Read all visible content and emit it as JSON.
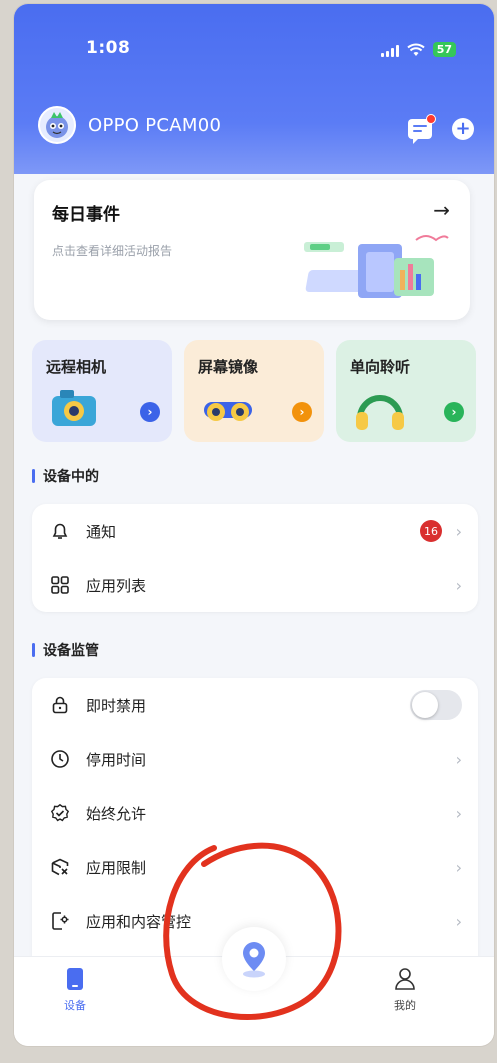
{
  "status": {
    "time": "1:08",
    "battery": "57"
  },
  "header": {
    "device_name": "OPPO PCAM00"
  },
  "daily": {
    "title": "每日事件",
    "subtitle": "点击查看详细活动报告"
  },
  "quick": [
    {
      "label": "远程相机"
    },
    {
      "label": "屏幕镜像"
    },
    {
      "label": "单向聆听"
    }
  ],
  "section_device": {
    "title": "设备中的",
    "items": [
      {
        "label": "通知",
        "badge": "16"
      },
      {
        "label": "应用列表"
      }
    ]
  },
  "section_monitor": {
    "title": "设备监管",
    "items": [
      {
        "label": "即时禁用"
      },
      {
        "label": "停用时间"
      },
      {
        "label": "始终允许"
      },
      {
        "label": "应用限制"
      },
      {
        "label": "应用和内容管控"
      }
    ]
  },
  "tabbar": {
    "device_label": "设备",
    "me_label": "我的"
  },
  "colors": {
    "accent": "#4a6df0",
    "badge": "#d92f2f",
    "scribble": "#e2321e"
  }
}
